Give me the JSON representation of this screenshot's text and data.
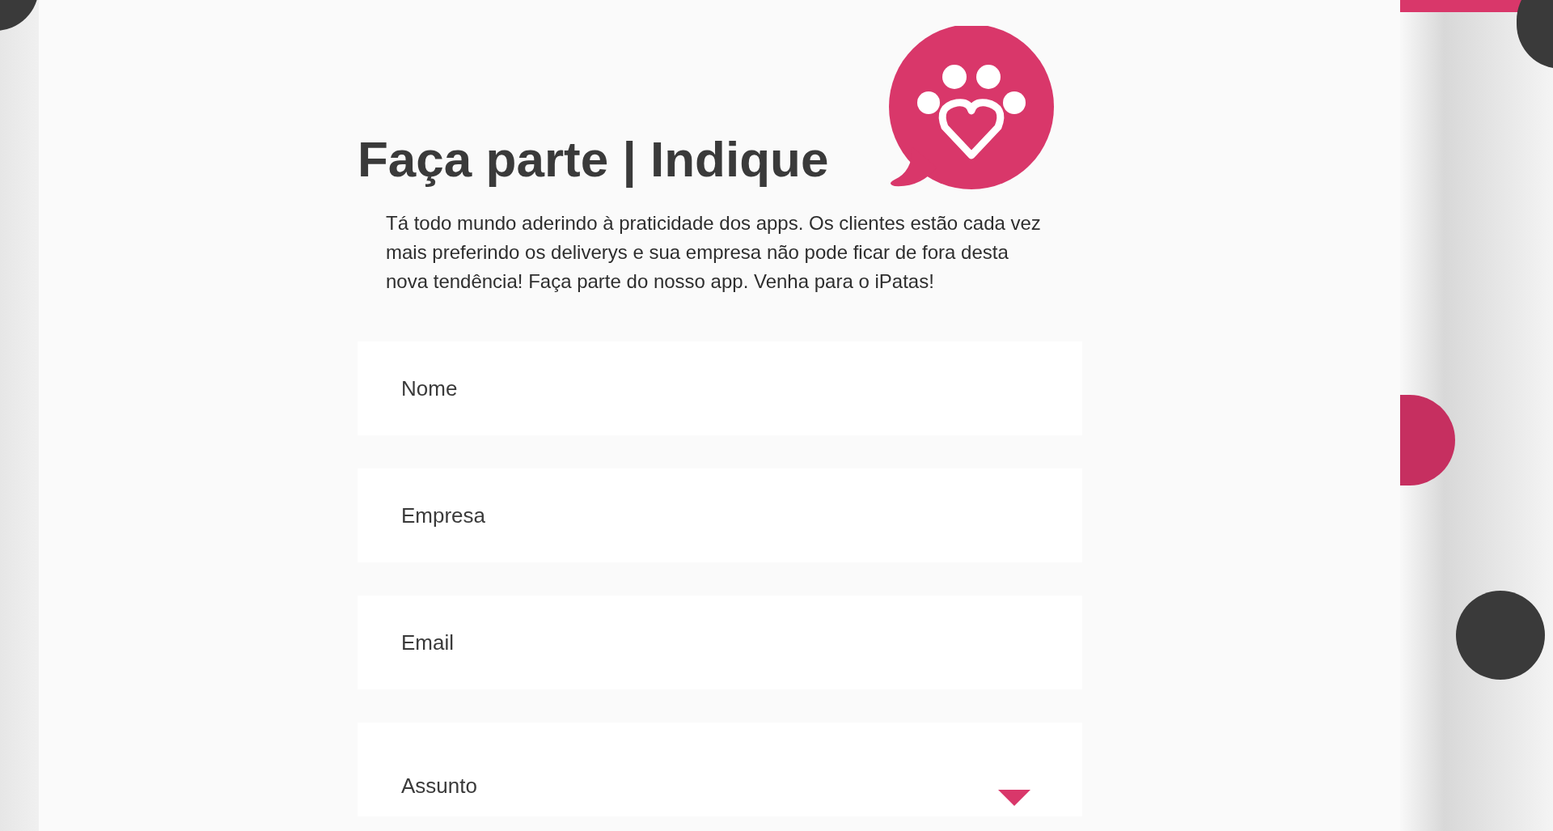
{
  "heading": "Faça parte | Indique",
  "intro": "Tá todo mundo aderindo à praticidade dos apps. Os clientes estão cada vez mais preferindo os deliverys e sua empresa não pode ficar de fora desta nova tendência! Faça parte do nosso app. Venha para o iPatas!",
  "fields": [
    {
      "kind": "text",
      "placeholder": "Nome"
    },
    {
      "kind": "text",
      "placeholder": "Empresa"
    },
    {
      "kind": "text",
      "placeholder": "Email"
    },
    {
      "kind": "select",
      "placeholder": "Assunto"
    }
  ]
}
